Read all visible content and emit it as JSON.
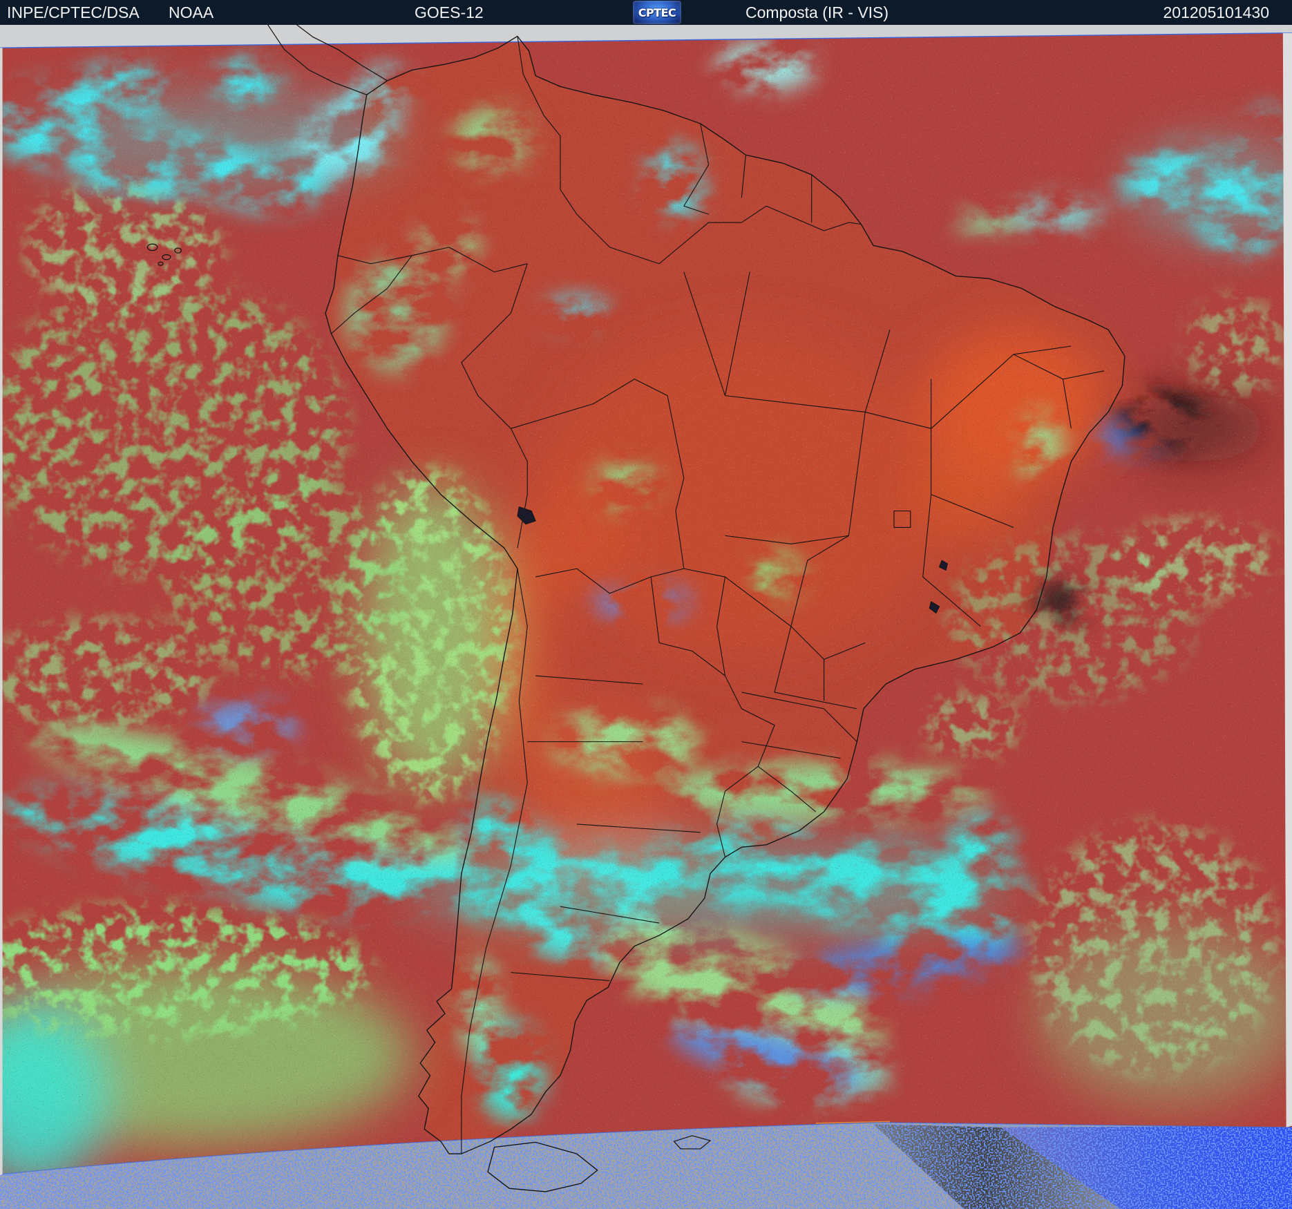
{
  "header": {
    "source": "INPE/CPTEC/DSA",
    "agency": "NOAA",
    "satellite": "GOES-12",
    "logo_text": "CPTEC",
    "product": "Composta (IR - VIS)",
    "timestamp": "201205101430"
  },
  "colors": {
    "header_bg": "#0c1a2a",
    "header_text": "#f2f2f2",
    "ocean": "#b1413d",
    "land": "#c44b30",
    "cloud_high": "#3ee6e0",
    "cloud_low": "#8fd27a",
    "space": "#a3a3a3"
  }
}
